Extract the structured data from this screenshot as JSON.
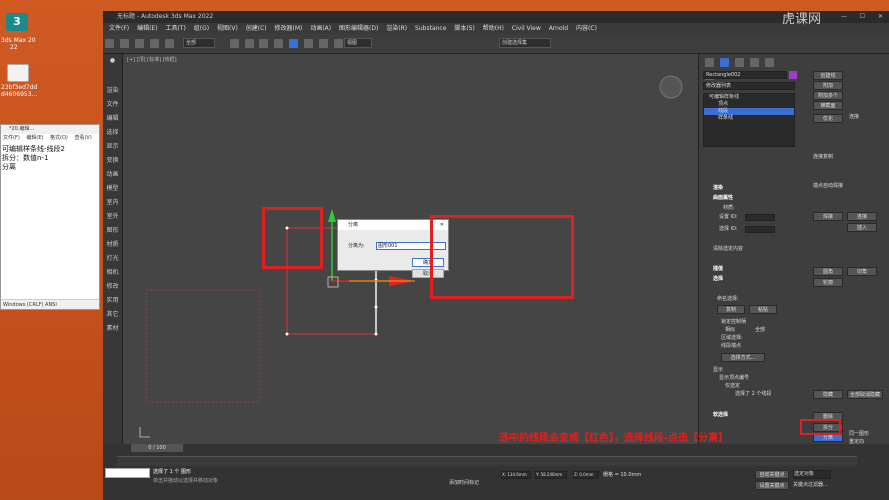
{
  "desktop": {
    "icon1_label_line1": "3ds Max 20",
    "icon1_label_line2": "22",
    "icon2_label_line1": "23bf3ed7dd",
    "icon2_label_line2": "d4606953..."
  },
  "notepad": {
    "title": "*20.编辑...",
    "menu": [
      "文件(F)",
      "编辑(E)",
      "格式(O)",
      "查看(V)"
    ],
    "lines": [
      "可编辑样条线-线段2",
      "拆分：数值n-1",
      "分离"
    ],
    "status": "Windows (CRLF)   ANSI"
  },
  "app": {
    "title": "无标题 - Autodesk 3ds Max 2022",
    "menus": [
      "文件(F)",
      "编辑(E)",
      "工具(T)",
      "组(G)",
      "视图(V)",
      "创建(C)",
      "修改器(M)",
      "动画(A)",
      "图形编辑器(D)",
      "渲染(R)",
      "Substance",
      "脚本(S)",
      "帮助(H)",
      "Civil View",
      "Substance",
      "Arnold",
      "内容(C)"
    ],
    "toolbar": {
      "filter_dropdown": "全部",
      "view_dropdown": "视图",
      "selection_set": "创建选择集"
    },
    "left_tabs": [
      "渲染",
      "文件",
      "编辑",
      "选择",
      "显示",
      "变换",
      "动画",
      "模型",
      "室内",
      "室外",
      "图形",
      "材质",
      "灯光",
      "相机",
      "修改",
      "实用",
      "其它",
      "素材"
    ],
    "viewport_label": "[+] [顶] [标准] [线框]"
  },
  "dialog": {
    "title": "分离",
    "label": "分离为:",
    "input_value": "图形001",
    "ok": "确定",
    "cancel": "取消"
  },
  "panel": {
    "object_name": "Rectangle002",
    "modifier_list": "修改器列表",
    "stack": [
      "可编辑样条线",
      "顶点",
      "线段",
      "样条线"
    ],
    "rollouts": [
      "渲染",
      "曲面属性",
      "插值",
      "选择",
      "软选择"
    ],
    "material_label": "材质:",
    "set_id": "设置 ID:",
    "select_id": "选择 ID:",
    "clear_selection": "清除选定内容",
    "named_selection": "命名选择:",
    "copy": "复制",
    "paste": "粘贴",
    "lock_handles": "锁定控制柄",
    "similar": "相似",
    "all": "全部",
    "area_select": "区域选择:",
    "segment_end": "线段端点",
    "select_by": "选择方式...",
    "display": "显示",
    "show_vertex_numbers": "显示顶点编号",
    "selected_only": "仅选定",
    "status": "选择了 2 个线段",
    "right_buttons": [
      "创建线",
      "附加",
      "附加多个",
      "横截面",
      "优化",
      "连接",
      "线性",
      "封闭",
      "绑定首点",
      "绑定末点",
      "连接复制",
      "端点自动焊接",
      "自动焊接",
      "阈值距离",
      "焊接",
      "连接",
      "插入",
      "设为首顶点",
      "熔合",
      "反转",
      "循环",
      "相交",
      "圆角",
      "切角",
      "轮廓",
      "布尔",
      "镜像",
      "修剪",
      "延伸",
      "无限边界",
      "切线",
      "复制",
      "粘贴",
      "隐藏",
      "全部取消隐藏",
      "绑定",
      "取消绑定",
      "删除",
      "拆分",
      "分离",
      "同一图形",
      "重定向",
      "复制"
    ],
    "divide_button": "分离"
  },
  "timeline": {
    "frame_counter": "0 / 100",
    "status_left": "选择了 1 个 图形",
    "status_hint": "单击并拖动以选择并移动对象",
    "x_value": "X: 134.6mm",
    "y_value": "Y: 58.246mm",
    "z_value": "Z: 0.0mm",
    "grid": "栅格 = 10.0mm",
    "auto_key": "自动关键点",
    "set_key": "设置关键点",
    "selected_obj": "选定对象",
    "key_filters": "关键点过滤器...",
    "add_time_tag": "添加时间标记"
  },
  "annotation": {
    "caption": "选中的线段会变成【红色】，选择线段-点击【分离】",
    "watermark": "虎课网"
  },
  "colors": {
    "highlight_red": "#e02020",
    "selection_blue": "#3b6fd4",
    "gizmo_green": "#2ecc2e",
    "gizmo_red": "#dd2222",
    "spline_white": "#f0f0f0"
  }
}
